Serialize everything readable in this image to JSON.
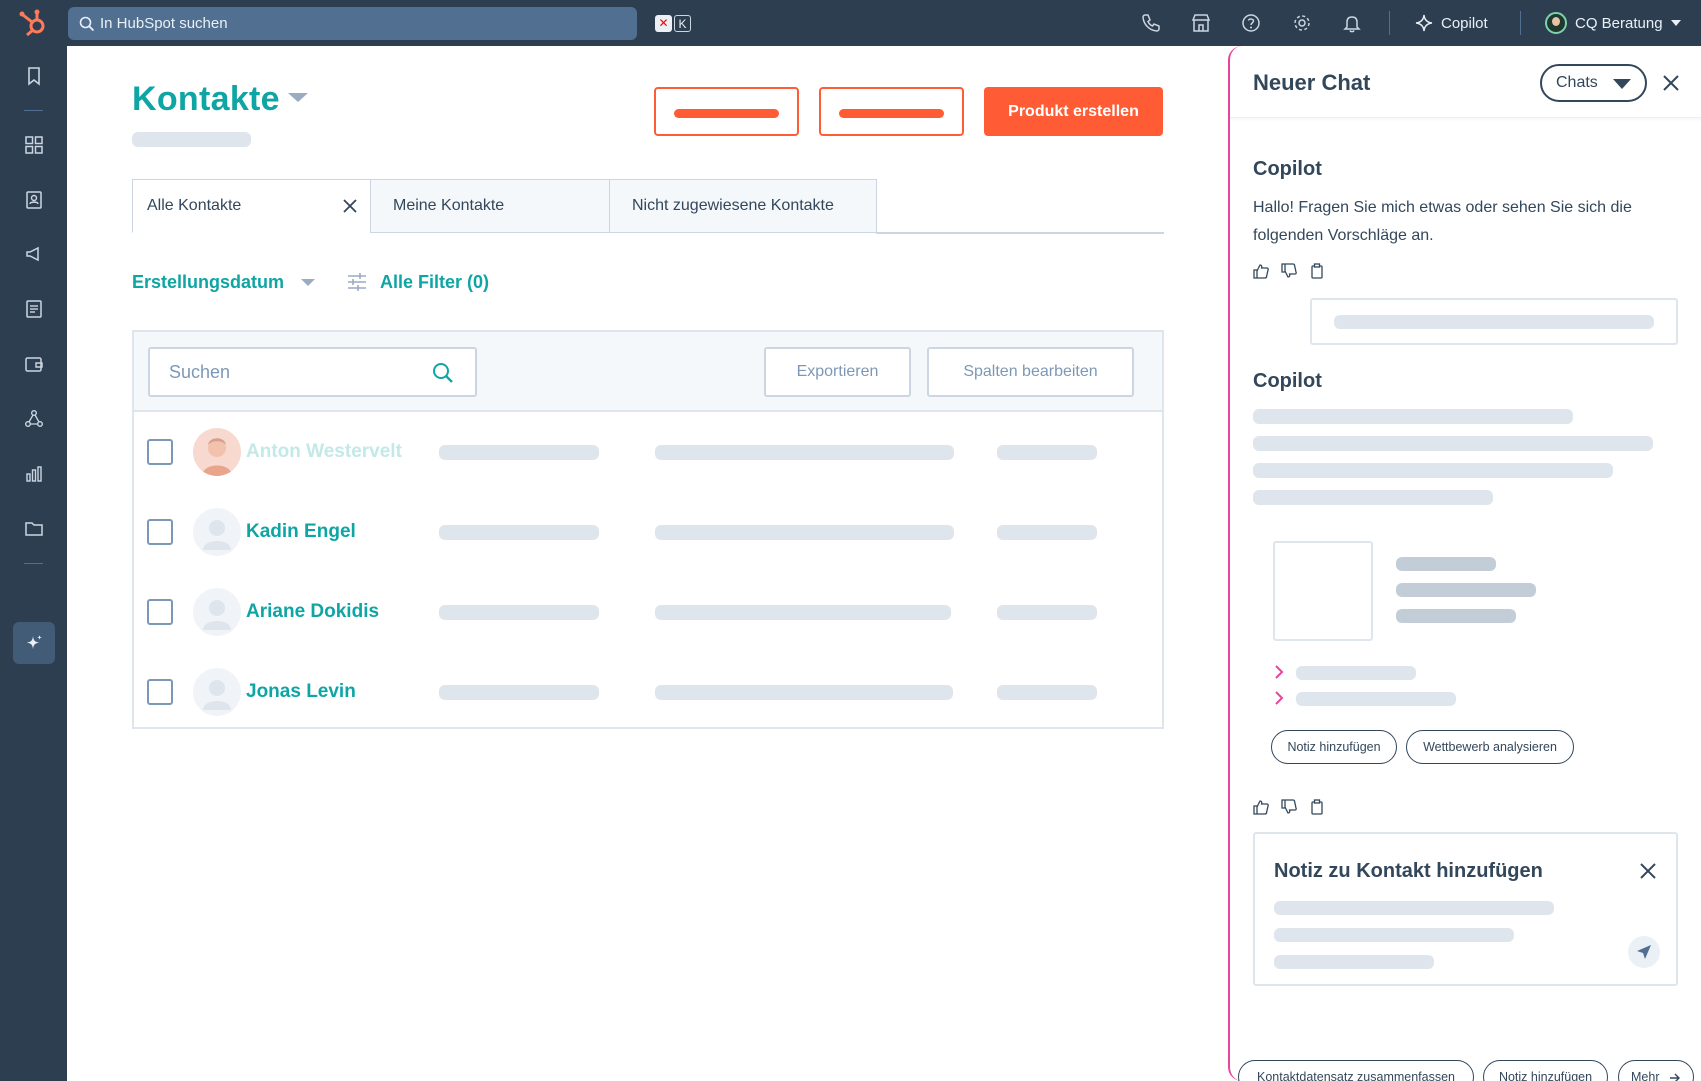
{
  "topbar": {
    "search_text": "In HubSpot suchen",
    "shortcut_key": "K",
    "copilot_label": "Copilot",
    "user_name": "CQ Beratung"
  },
  "main": {
    "title": "Kontakte",
    "create_button": "Produkt erstellen",
    "tabs": [
      {
        "label": "Alle Kontakte"
      },
      {
        "label": "Meine Kontakte"
      },
      {
        "label": "Nicht zugewiesene Kontakte"
      }
    ],
    "filters": {
      "date_label": "Erstellungsdatum",
      "all_filters_label": "Alle Filter (0)"
    },
    "table": {
      "search_placeholder": "Suchen",
      "export_button": "Exportieren",
      "edit_columns_button": "Spalten bearbeiten",
      "rows": [
        {
          "name": "Anton Westervelt"
        },
        {
          "name": "Kadin Engel"
        },
        {
          "name": "Ariane Dokidis"
        },
        {
          "name": "Jonas Levin"
        }
      ]
    }
  },
  "panel": {
    "title": "Neuer Chat",
    "chats_button": "Chats",
    "copilot_heading_1": "Copilot",
    "greeting": "Hallo! Fragen Sie mich etwas oder sehen Sie sich die folgenden Vorschläge an.",
    "copilot_heading_2": "Copilot",
    "chips_inline": [
      "Notiz hinzufügen",
      "Wettbewerb analysieren"
    ],
    "note_card_title": "Notiz zu Kontakt hinzufügen",
    "suggestions": [
      "Kontaktdatensatz zusammenfassen",
      "Notiz hinzufügen",
      "Mehr"
    ]
  },
  "colors": {
    "accent_teal": "#0fa5a5",
    "brand_orange": "#ff5c35",
    "nav_dark": "#2d3e50",
    "panel_border_pink": "#e8469a"
  }
}
